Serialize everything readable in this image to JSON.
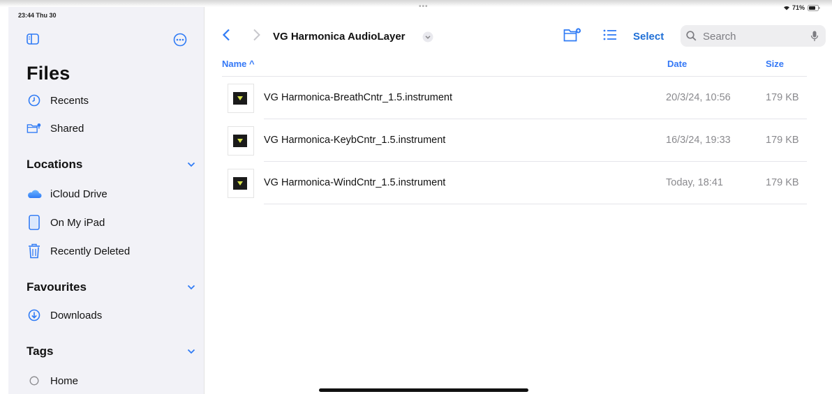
{
  "status": {
    "time": "23:44  Thu 30",
    "dots": "•••",
    "battery": "71%"
  },
  "sidebar": {
    "title": "Files",
    "top_items": [
      {
        "label": "Recents",
        "icon": "clock-icon"
      },
      {
        "label": "Shared",
        "icon": "shared-folder-icon"
      }
    ],
    "locations": {
      "header": "Locations",
      "items": [
        {
          "label": "iCloud Drive",
          "icon": "icloud-icon"
        },
        {
          "label": "On My iPad",
          "icon": "ipad-icon"
        },
        {
          "label": "Recently Deleted",
          "icon": "trash-icon"
        }
      ]
    },
    "favourites": {
      "header": "Favourites",
      "items": [
        {
          "label": "Downloads",
          "icon": "download-icon"
        }
      ]
    },
    "tags": {
      "header": "Tags",
      "items": [
        {
          "label": "Home",
          "icon": "tag-circle-icon"
        }
      ]
    }
  },
  "toolbar": {
    "folder_title": "VG Harmonica AudioLayer",
    "select_label": "Select",
    "search_placeholder": "Search"
  },
  "columns": {
    "name": "Name ^",
    "date": "Date",
    "size": "Size"
  },
  "files": [
    {
      "name": "VG Harmonica-BreathCntr_1.5.instrument",
      "date": "20/3/24, 10:56",
      "size": "179 KB"
    },
    {
      "name": "VG Harmonica-KeybCntr_1.5.instrument",
      "date": "16/3/24, 19:33",
      "size": "179 KB"
    },
    {
      "name": "VG Harmonica-WindCntr_1.5.instrument",
      "date": "Today, 18:41",
      "size": "179 KB"
    }
  ],
  "colors": {
    "accent": "#3478f6",
    "sidebar_bg": "#f2f2f7",
    "file_icon_accent": "#d7e24a"
  }
}
